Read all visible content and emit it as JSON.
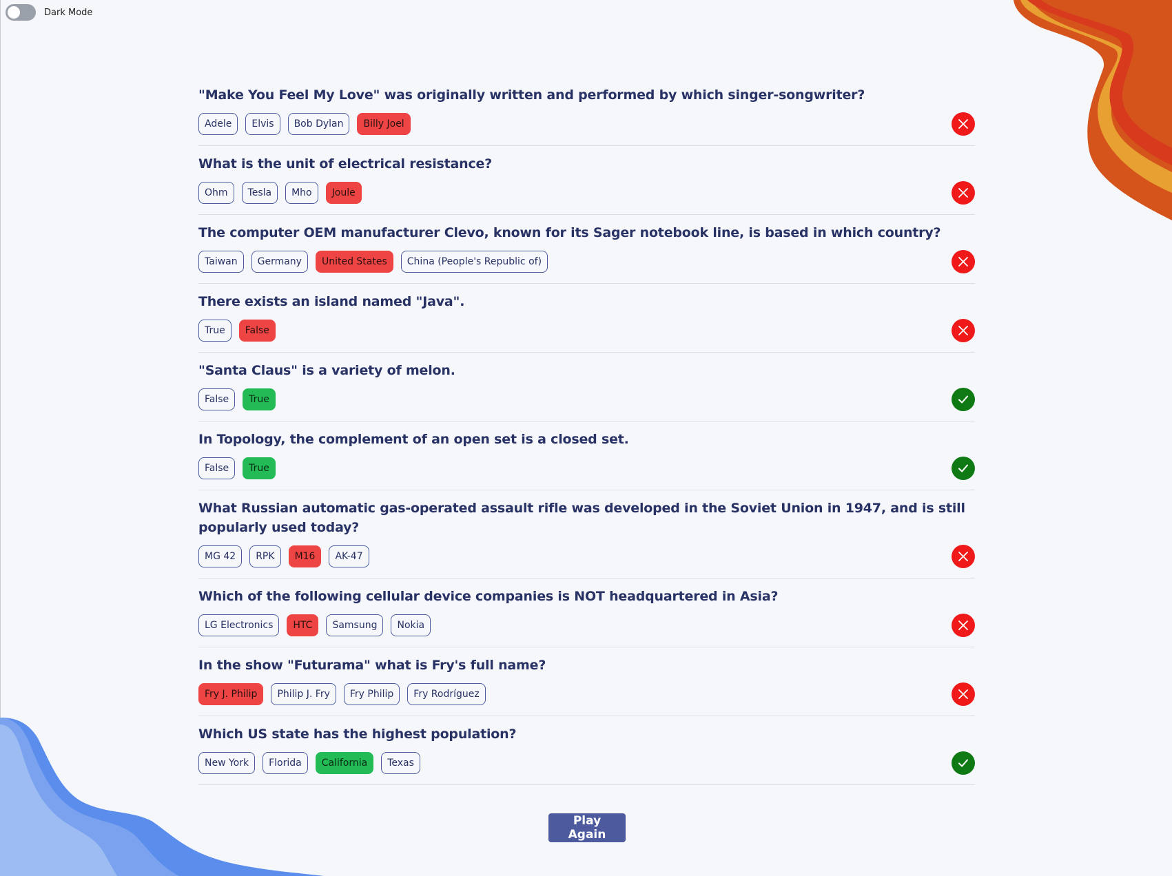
{
  "settings": {
    "dark_mode_label": "Dark Mode",
    "dark_mode_on": false
  },
  "colors": {
    "background": "#f5f7fb",
    "accent": "#4d5b9e",
    "wrong": "#ee4444",
    "right": "#22bb55",
    "wrong_icon": "#f01919",
    "right_icon": "#0f7a14"
  },
  "questions": [
    {
      "text": "\"Make You Feel My Love\" was originally written and performed by which singer-songwriter?",
      "answers": [
        {
          "label": "Adele",
          "state": "none"
        },
        {
          "label": "Elvis",
          "state": "none"
        },
        {
          "label": "Bob Dylan",
          "state": "none"
        },
        {
          "label": "Billy Joel",
          "state": "wrong"
        }
      ],
      "result_icon": "x-icon",
      "result": "wrong"
    },
    {
      "text": "What is the unit of electrical resistance?",
      "answers": [
        {
          "label": "Ohm",
          "state": "none"
        },
        {
          "label": "Tesla",
          "state": "none"
        },
        {
          "label": "Mho",
          "state": "none"
        },
        {
          "label": "Joule",
          "state": "wrong"
        }
      ],
      "result_icon": "x-icon",
      "result": "wrong"
    },
    {
      "text": "The computer OEM manufacturer Clevo, known for its Sager notebook line, is based in which country?",
      "answers": [
        {
          "label": "Taiwan",
          "state": "none"
        },
        {
          "label": "Germany",
          "state": "none"
        },
        {
          "label": "United States",
          "state": "wrong"
        },
        {
          "label": "China (People's Republic of)",
          "state": "none"
        }
      ],
      "result_icon": "x-icon",
      "result": "wrong"
    },
    {
      "text": "There exists an island named \"Java\".",
      "answers": [
        {
          "label": "True",
          "state": "none"
        },
        {
          "label": "False",
          "state": "wrong"
        }
      ],
      "result_icon": "x-icon",
      "result": "wrong"
    },
    {
      "text": "\"Santa Claus\" is a variety of melon.",
      "answers": [
        {
          "label": "False",
          "state": "none"
        },
        {
          "label": "True",
          "state": "right"
        }
      ],
      "result_icon": "check-icon",
      "result": "right"
    },
    {
      "text": "In Topology, the complement of an open set is a closed set.",
      "answers": [
        {
          "label": "False",
          "state": "none"
        },
        {
          "label": "True",
          "state": "right"
        }
      ],
      "result_icon": "check-icon",
      "result": "right"
    },
    {
      "text": "What Russian automatic gas-operated assault rifle was developed in the Soviet Union in 1947, and is still popularly used today?",
      "answers": [
        {
          "label": "MG 42",
          "state": "none"
        },
        {
          "label": "RPK",
          "state": "none"
        },
        {
          "label": "M16",
          "state": "wrong"
        },
        {
          "label": "AK-47",
          "state": "none"
        }
      ],
      "result_icon": "x-icon",
      "result": "wrong"
    },
    {
      "text": "Which of the following cellular device companies is NOT headquartered in Asia?",
      "answers": [
        {
          "label": "LG Electronics",
          "state": "none"
        },
        {
          "label": "HTC",
          "state": "wrong"
        },
        {
          "label": "Samsung",
          "state": "none"
        },
        {
          "label": "Nokia",
          "state": "none"
        }
      ],
      "result_icon": "x-icon",
      "result": "wrong"
    },
    {
      "text": "In the show \"Futurama\" what is Fry's full name?",
      "answers": [
        {
          "label": "Fry J. Philip",
          "state": "wrong"
        },
        {
          "label": "Philip J. Fry",
          "state": "none"
        },
        {
          "label": "Fry Philip",
          "state": "none"
        },
        {
          "label": "Fry Rodríguez",
          "state": "none"
        }
      ],
      "result_icon": "x-icon",
      "result": "wrong"
    },
    {
      "text": "Which US state has the highest population?",
      "answers": [
        {
          "label": "New York",
          "state": "none"
        },
        {
          "label": "Florida",
          "state": "none"
        },
        {
          "label": "California",
          "state": "right"
        },
        {
          "label": "Texas",
          "state": "none"
        }
      ],
      "result_icon": "check-icon",
      "result": "right"
    }
  ],
  "play_again_label": "Play Again"
}
